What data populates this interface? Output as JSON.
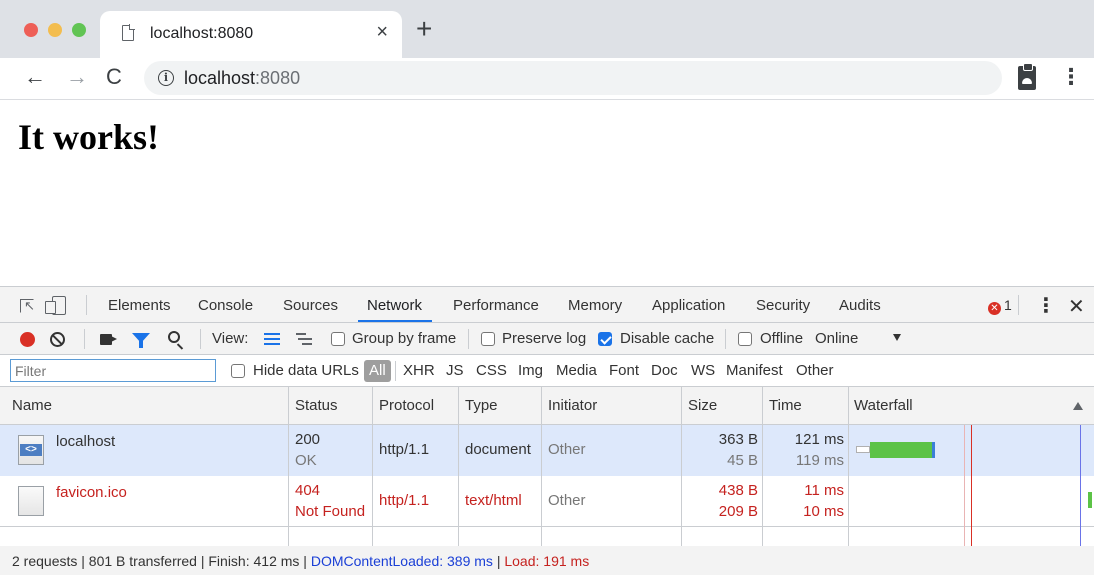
{
  "browser": {
    "tab_title": "localhost:8080",
    "tab_close": "×",
    "new_tab": "+",
    "back": "←",
    "forward": "→",
    "reload": "C",
    "url_host": "localhost",
    "url_port": ":8080",
    "info_glyph": "i",
    "menu": "⋮"
  },
  "page": {
    "heading": "It works!"
  },
  "devtools": {
    "tabs": [
      "Elements",
      "Console",
      "Sources",
      "Network",
      "Performance",
      "Memory",
      "Application",
      "Security",
      "Audits"
    ],
    "active_tab": "Network",
    "error_count": "1",
    "error_glyph": "✕",
    "more": "⋮",
    "close": "✕",
    "toolbar": {
      "view_label": "View:",
      "group_by_frame": "Group by frame",
      "preserve_log": "Preserve log",
      "disable_cache": "Disable cache",
      "disable_cache_checked": true,
      "offline": "Offline",
      "throttling": "Online"
    },
    "filter": {
      "placeholder": "Filter",
      "hide_data_urls": "Hide data URLs",
      "types": [
        "All",
        "XHR",
        "JS",
        "CSS",
        "Img",
        "Media",
        "Font",
        "Doc",
        "WS",
        "Manifest",
        "Other"
      ],
      "selected_type": "All"
    },
    "columns": [
      "Name",
      "Status",
      "Protocol",
      "Type",
      "Initiator",
      "Size",
      "Time",
      "Waterfall"
    ],
    "requests": [
      {
        "name": "localhost",
        "status_code": "200",
        "status_text": "OK",
        "protocol": "http/1.1",
        "type": "document",
        "initiator": "Other",
        "size": "363 B",
        "resource_size": "45 B",
        "time": "121 ms",
        "latency": "119 ms",
        "icon": "html-document-icon"
      },
      {
        "name": "favicon.ico",
        "status_code": "404",
        "status_text": "Not Found",
        "protocol": "http/1.1",
        "type": "text/html",
        "initiator": "Other",
        "size": "438 B",
        "resource_size": "209 B",
        "time": "11 ms",
        "latency": "10 ms",
        "icon": "blank-document-icon"
      }
    ],
    "summary": {
      "main": "2 requests | 801 B transferred | Finish: 412 ms | ",
      "dom_content_loaded": "DOMContentLoaded: 389 ms",
      "separator": " | ",
      "load": "Load: 191 ms"
    },
    "colors": {
      "accent": "#1a73e8",
      "error": "#c5221f",
      "selected_row": "#dde8fb",
      "waterfall_green": "#5cc346",
      "dom_line": "#6a73e8",
      "load_line": "#d93025"
    }
  }
}
